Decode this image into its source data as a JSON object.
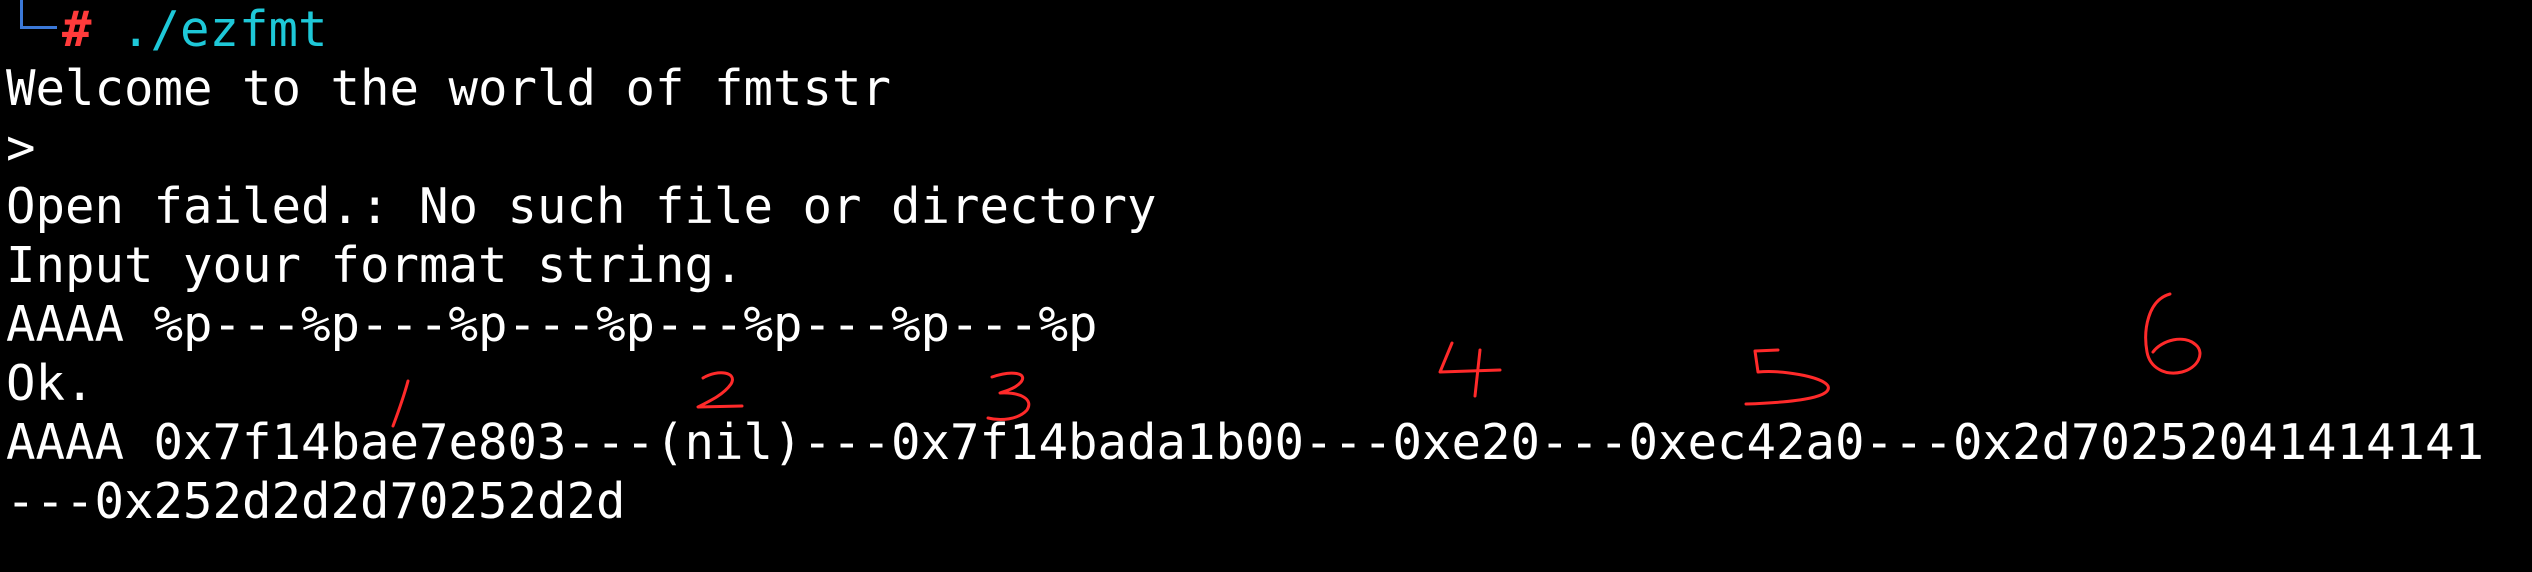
{
  "prompt": {
    "symbol": "#",
    "command": " ./ezfmt"
  },
  "output": [
    "Welcome to the world of fmtstr",
    ">",
    "Open failed.: No such file or directory",
    "Input your format string.",
    "AAAA %p---%p---%p---%p---%p---%p---%p",
    "Ok.",
    "AAAA 0x7f14bae7e803---(nil)---0x7f14bada1b00---0xe20---0xec42a0---0x2d70252041414141",
    "---0x252d2d2d70252d2d"
  ],
  "annotations": [
    "1",
    "2",
    "3",
    "4",
    "5",
    "6"
  ],
  "colors": {
    "background": "#000000",
    "text": "#ffffff",
    "prompt_hash": "#ff3b3b",
    "command": "#1ec8d8",
    "prompt_frame": "#3b78d8",
    "annotation": "#ff2a2a"
  }
}
